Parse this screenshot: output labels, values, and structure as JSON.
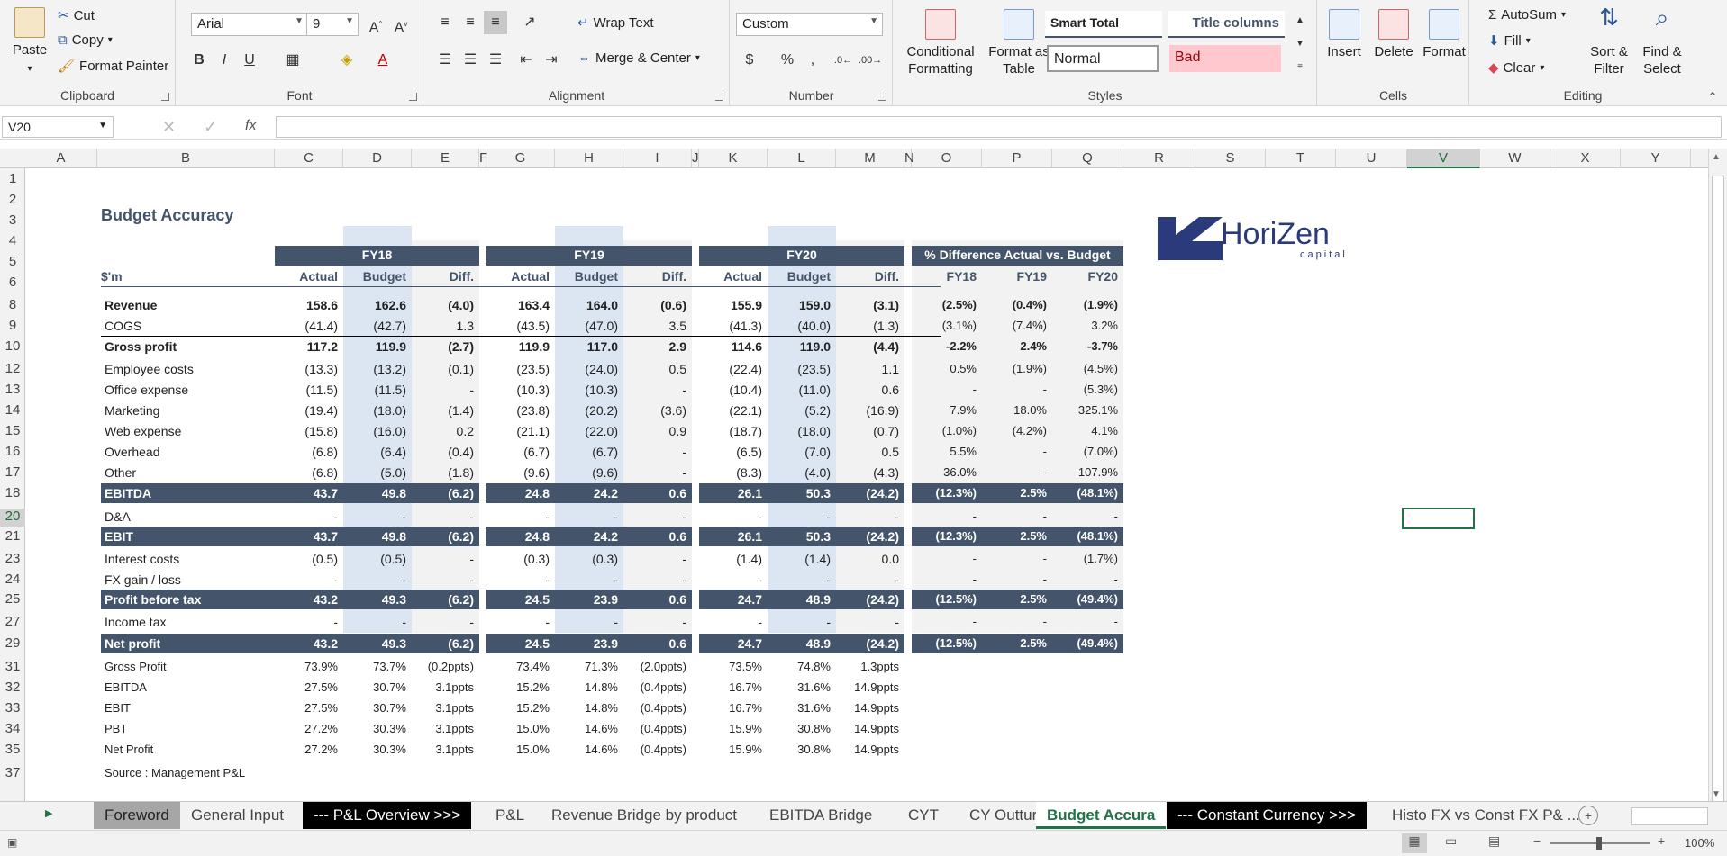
{
  "ribbon": {
    "clipboard": {
      "label": "Clipboard",
      "paste": "Paste",
      "cut": "Cut",
      "copy": "Copy",
      "format_painter": "Format Painter"
    },
    "font": {
      "label": "Font",
      "name": "Arial",
      "size": "9",
      "bold": "B",
      "italic": "I",
      "underline": "U"
    },
    "alignment": {
      "label": "Alignment",
      "wrap": "Wrap Text",
      "merge": "Merge & Center"
    },
    "number": {
      "label": "Number",
      "format": "Custom",
      "percent": "%",
      "comma": ","
    },
    "styles": {
      "label": "Styles",
      "conditional": "Conditional Formatting",
      "format_table": "Format as Table",
      "smart_total": "Smart Total",
      "title_columns": "Title columns",
      "normal": "Normal",
      "bad": "Bad"
    },
    "cells": {
      "label": "Cells",
      "insert": "Insert",
      "delete": "Delete",
      "format": "Format"
    },
    "editing": {
      "label": "Editing",
      "autosum": "AutoSum",
      "fill": "Fill",
      "clear": "Clear",
      "sort": "Sort & Filter",
      "find": "Find & Select"
    }
  },
  "formula_bar": {
    "name_box": "V20",
    "fx": "fx",
    "value": ""
  },
  "columns": [
    "A",
    "B",
    "C",
    "D",
    "E",
    "F",
    "G",
    "H",
    "I",
    "J",
    "K",
    "L",
    "M",
    "N",
    "O",
    "P",
    "Q",
    "R",
    "S",
    "T",
    "U",
    "V",
    "W",
    "X",
    "Y"
  ],
  "selected_column": "V",
  "rows": [
    "1",
    "2",
    "3",
    "4",
    "5",
    "6",
    "8",
    "9",
    "10",
    "12",
    "13",
    "14",
    "15",
    "16",
    "17",
    "18",
    "20",
    "21",
    "23",
    "24",
    "25",
    "27",
    "29",
    "31",
    "32",
    "33",
    "34",
    "35",
    "37"
  ],
  "selected_row": "20",
  "sheet": {
    "title": "Budget Accuracy",
    "unit_label": "$'m",
    "groups": [
      "FY18",
      "FY19",
      "FY20"
    ],
    "pct_group": "% Difference Actual vs. Budget",
    "subheads": [
      "Actual",
      "Budget",
      "Diff."
    ],
    "pct_subheads": [
      "FY18",
      "FY19",
      "FY20"
    ],
    "lines": [
      {
        "label": "Revenue",
        "style": "bold",
        "vals": [
          "158.6",
          "162.6",
          "(4.0)",
          "163.4",
          "164.0",
          "(0.6)",
          "155.9",
          "159.0",
          "(3.1)",
          "(2.5%)",
          "(0.4%)",
          "(1.9%)"
        ]
      },
      {
        "label": "COGS",
        "style": "normal",
        "vals": [
          "(41.4)",
          "(42.7)",
          "1.3",
          "(43.5)",
          "(47.0)",
          "3.5",
          "(41.3)",
          "(40.0)",
          "(1.3)",
          "(3.1%)",
          "(7.4%)",
          "3.2%"
        ]
      },
      {
        "label": "Gross profit",
        "style": "bold",
        "vals": [
          "117.2",
          "119.9",
          "(2.7)",
          "119.9",
          "117.0",
          "2.9",
          "114.6",
          "119.0",
          "(4.4)",
          "-2.2%",
          "2.4%",
          "-3.7%"
        ]
      },
      {
        "label": "Employee costs",
        "style": "normal",
        "vals": [
          "(13.3)",
          "(13.2)",
          "(0.1)",
          "(23.5)",
          "(24.0)",
          "0.5",
          "(22.4)",
          "(23.5)",
          "1.1",
          "0.5%",
          "(1.9%)",
          "(4.5%)"
        ]
      },
      {
        "label": "Office expense",
        "style": "normal",
        "vals": [
          "(11.5)",
          "(11.5)",
          "-",
          "(10.3)",
          "(10.3)",
          "-",
          "(10.4)",
          "(11.0)",
          "0.6",
          "-",
          "-",
          "(5.3%)"
        ]
      },
      {
        "label": "Marketing",
        "style": "normal",
        "vals": [
          "(19.4)",
          "(18.0)",
          "(1.4)",
          "(23.8)",
          "(20.2)",
          "(3.6)",
          "(22.1)",
          "(5.2)",
          "(16.9)",
          "7.9%",
          "18.0%",
          "325.1%"
        ]
      },
      {
        "label": "Web expense",
        "style": "normal",
        "vals": [
          "(15.8)",
          "(16.0)",
          "0.2",
          "(21.1)",
          "(22.0)",
          "0.9",
          "(18.7)",
          "(18.0)",
          "(0.7)",
          "(1.0%)",
          "(4.2%)",
          "4.1%"
        ]
      },
      {
        "label": "Overhead",
        "style": "normal",
        "vals": [
          "(6.8)",
          "(6.4)",
          "(0.4)",
          "(6.7)",
          "(6.7)",
          "-",
          "(6.5)",
          "(7.0)",
          "0.5",
          "5.5%",
          "-",
          "(7.0%)"
        ]
      },
      {
        "label": "Other",
        "style": "normal",
        "vals": [
          "(6.8)",
          "(5.0)",
          "(1.8)",
          "(9.6)",
          "(9.6)",
          "-",
          "(8.3)",
          "(4.0)",
          "(4.3)",
          "36.0%",
          "-",
          "107.9%"
        ]
      },
      {
        "label": "EBITDA",
        "style": "dark",
        "vals": [
          "43.7",
          "49.8",
          "(6.2)",
          "24.8",
          "24.2",
          "0.6",
          "26.1",
          "50.3",
          "(24.2)",
          "(12.3%)",
          "2.5%",
          "(48.1%)"
        ]
      },
      {
        "label": "D&A",
        "style": "normal",
        "vals": [
          "-",
          "-",
          "-",
          "-",
          "-",
          "-",
          "-",
          "-",
          "-",
          "-",
          "-",
          "-"
        ]
      },
      {
        "label": "EBIT",
        "style": "dark",
        "vals": [
          "43.7",
          "49.8",
          "(6.2)",
          "24.8",
          "24.2",
          "0.6",
          "26.1",
          "50.3",
          "(24.2)",
          "(12.3%)",
          "2.5%",
          "(48.1%)"
        ]
      },
      {
        "label": "Interest costs",
        "style": "normal",
        "vals": [
          "(0.5)",
          "(0.5)",
          "-",
          "(0.3)",
          "(0.3)",
          "-",
          "(1.4)",
          "(1.4)",
          "0.0",
          "-",
          "-",
          "(1.7%)"
        ]
      },
      {
        "label": "FX gain / loss",
        "style": "normal",
        "vals": [
          "-",
          "-",
          "-",
          "-",
          "-",
          "-",
          "-",
          "-",
          "-",
          "-",
          "-",
          "-"
        ]
      },
      {
        "label": "Profit before tax",
        "style": "dark",
        "vals": [
          "43.2",
          "49.3",
          "(6.2)",
          "24.5",
          "23.9",
          "0.6",
          "24.7",
          "48.9",
          "(24.2)",
          "(12.5%)",
          "2.5%",
          "(49.4%)"
        ]
      },
      {
        "label": "Income tax",
        "style": "normal",
        "vals": [
          "-",
          "-",
          "-",
          "-",
          "-",
          "-",
          "-",
          "-",
          "-",
          "-",
          "-",
          "-"
        ]
      },
      {
        "label": "Net profit",
        "style": "dark",
        "vals": [
          "43.2",
          "49.3",
          "(6.2)",
          "24.5",
          "23.9",
          "0.6",
          "24.7",
          "48.9",
          "(24.2)",
          "(12.5%)",
          "2.5%",
          "(49.4%)"
        ]
      }
    ],
    "margins": [
      {
        "label": "Gross Profit",
        "vals": [
          "73.9%",
          "73.7%",
          "(0.2ppts)",
          "73.4%",
          "71.3%",
          "(2.0ppts)",
          "73.5%",
          "74.8%",
          "1.3ppts"
        ]
      },
      {
        "label": "EBITDA",
        "vals": [
          "27.5%",
          "30.7%",
          "3.1ppts",
          "15.2%",
          "14.8%",
          "(0.4ppts)",
          "16.7%",
          "31.6%",
          "14.9ppts"
        ]
      },
      {
        "label": "EBIT",
        "vals": [
          "27.5%",
          "30.7%",
          "3.1ppts",
          "15.2%",
          "14.8%",
          "(0.4ppts)",
          "16.7%",
          "31.6%",
          "14.9ppts"
        ]
      },
      {
        "label": "PBT",
        "vals": [
          "27.2%",
          "30.3%",
          "3.1ppts",
          "15.0%",
          "14.6%",
          "(0.4ppts)",
          "15.9%",
          "30.8%",
          "14.9ppts"
        ]
      },
      {
        "label": "Net Profit",
        "vals": [
          "27.2%",
          "30.3%",
          "3.1ppts",
          "15.0%",
          "14.6%",
          "(0.4ppts)",
          "15.9%",
          "30.8%",
          "14.9ppts"
        ]
      }
    ],
    "source": "Source : Management P&L",
    "logo_text": "HoriZen",
    "logo_sub": "capital"
  },
  "tabs": [
    {
      "label": "Foreword",
      "kind": "grey"
    },
    {
      "label": "General Input",
      "kind": "normal"
    },
    {
      "label": "--- P&L Overview >>>",
      "kind": "black"
    },
    {
      "label": "P&L",
      "kind": "normal"
    },
    {
      "label": "Revenue Bridge by product",
      "kind": "normal"
    },
    {
      "label": "EBITDA Bridge",
      "kind": "normal"
    },
    {
      "label": "CYT",
      "kind": "normal"
    },
    {
      "label": "CY Outturn",
      "kind": "normal"
    },
    {
      "label": "Budget Accura",
      "kind": "active"
    },
    {
      "label": "--- Constant Currency >>>",
      "kind": "black"
    },
    {
      "label": "Histo FX vs Const FX P& ...",
      "kind": "normal"
    }
  ],
  "status": {
    "zoom": "100%"
  }
}
